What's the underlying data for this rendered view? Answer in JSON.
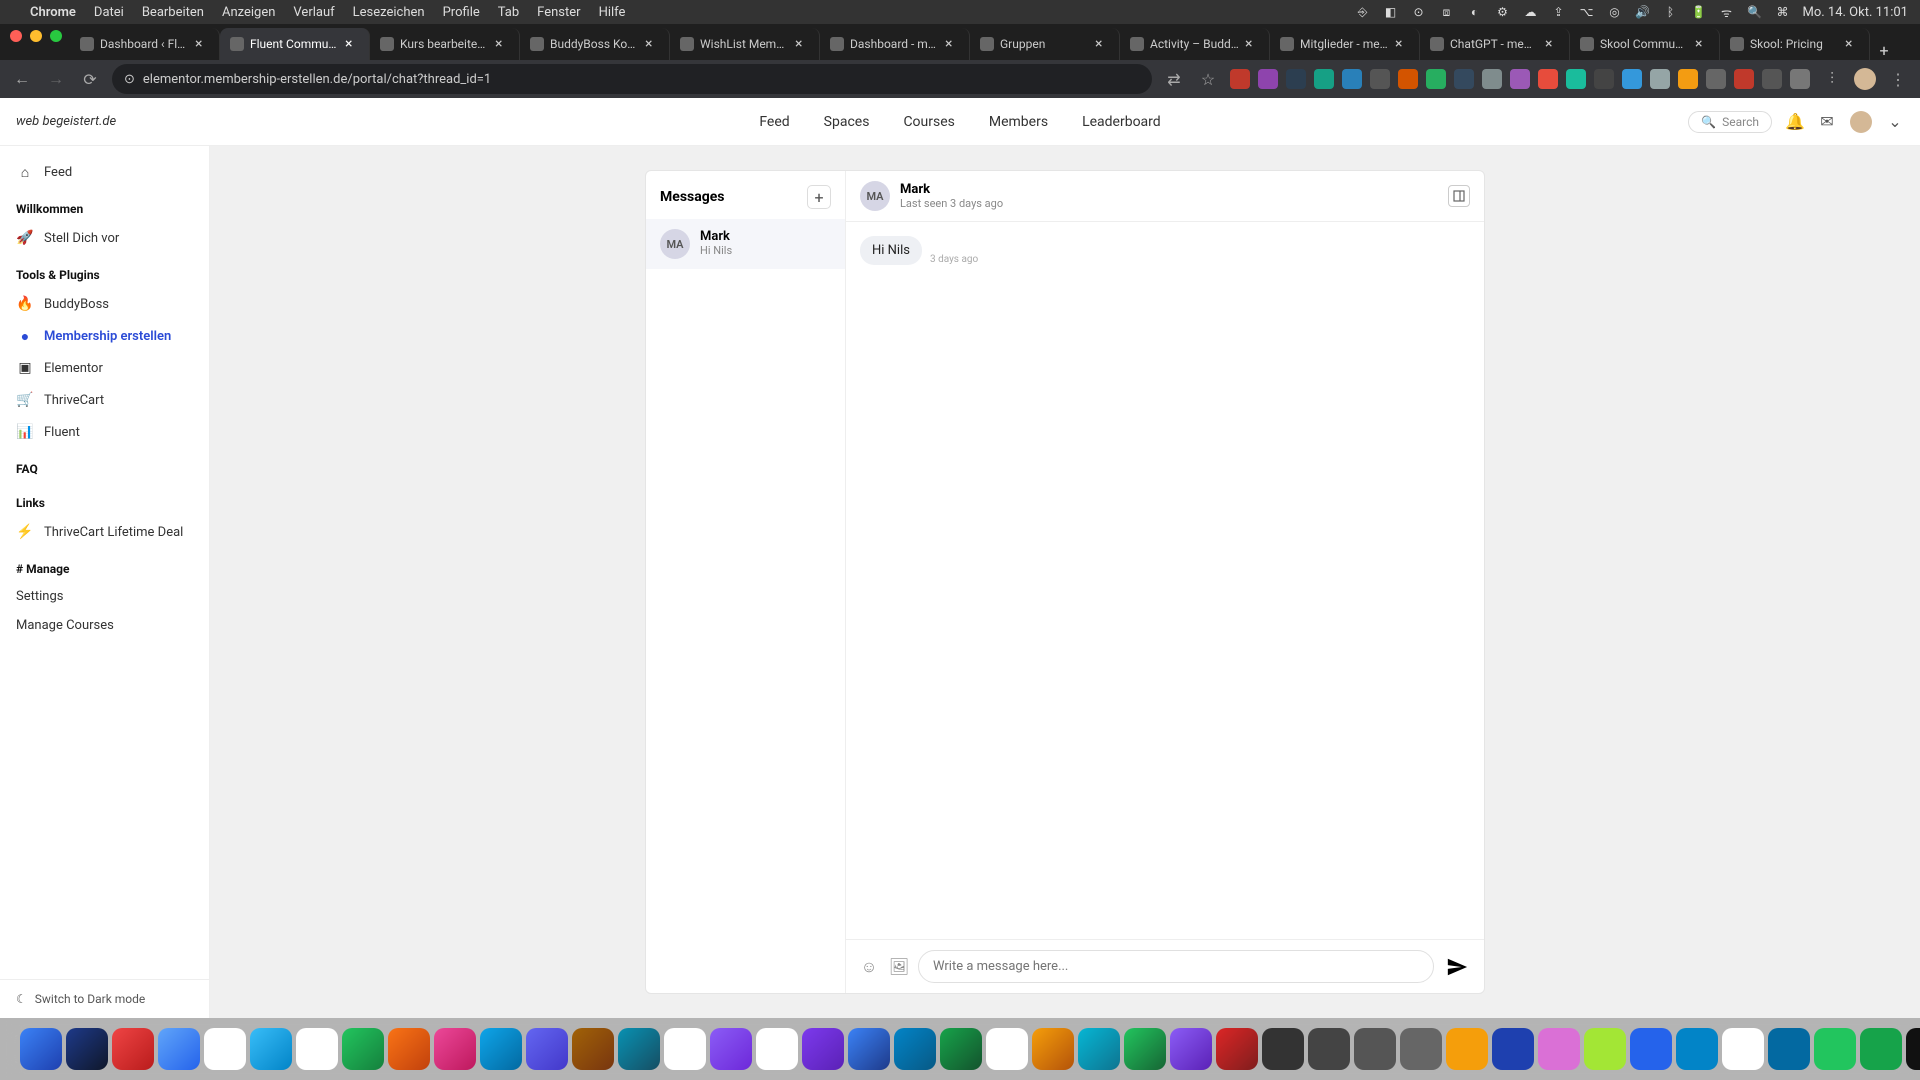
{
  "menubar": {
    "app": "Chrome",
    "items": [
      "Datei",
      "Bearbeiten",
      "Anzeigen",
      "Verlauf",
      "Lesezeichen",
      "Profile",
      "Tab",
      "Fenster",
      "Hilfe"
    ],
    "clock": "Mo. 14. Okt.  11:01"
  },
  "browser": {
    "tabs": [
      {
        "title": "Dashboard ‹ Fluent C"
      },
      {
        "title": "Fluent Community",
        "active": true
      },
      {
        "title": "Kurs bearbeiten „Ac"
      },
      {
        "title": "BuddyBoss Kompone"
      },
      {
        "title": "WishList Member | S"
      },
      {
        "title": "Dashboard - members"
      },
      {
        "title": "Gruppen"
      },
      {
        "title": "Activity – BuddyBoss"
      },
      {
        "title": "Mitglieder - members"
      },
      {
        "title": "ChatGPT - members"
      },
      {
        "title": "Skool Community"
      },
      {
        "title": "Skool: Pricing"
      }
    ],
    "url": "elementor.membership-erstellen.de/portal/chat?thread_id=1"
  },
  "header": {
    "logo": "web begeistert.de",
    "nav": [
      "Feed",
      "Spaces",
      "Courses",
      "Members",
      "Leaderboard"
    ],
    "search_placeholder": "Search"
  },
  "sidebar": {
    "feed": "Feed",
    "groups": [
      {
        "heading": "Willkommen",
        "items": [
          {
            "icon": "🚀",
            "label": "Stell Dich vor"
          }
        ]
      },
      {
        "heading": "Tools & Plugins",
        "items": [
          {
            "icon": "🔥",
            "label": "BuddyBoss"
          },
          {
            "icon": "●",
            "label": "Membership erstellen",
            "active": true
          },
          {
            "icon": "▣",
            "label": "Elementor"
          },
          {
            "icon": "🛒",
            "label": "ThriveCart"
          },
          {
            "icon": "📊",
            "label": "Fluent"
          }
        ]
      },
      {
        "heading": "FAQ",
        "items": []
      },
      {
        "heading": "Links",
        "items": [
          {
            "icon": "⚡",
            "label": "ThriveCart Lifetime Deal"
          }
        ]
      },
      {
        "heading": "# Manage",
        "items": [
          {
            "icon": "",
            "label": "Settings"
          },
          {
            "icon": "",
            "label": "Manage Courses"
          }
        ]
      }
    ],
    "dark_mode": "Switch to Dark mode"
  },
  "messenger": {
    "title": "Messages",
    "threads": [
      {
        "avatar": "MA",
        "name": "Mark",
        "preview": "Hi Nils"
      }
    ],
    "chat": {
      "avatar": "MA",
      "name": "Mark",
      "sub": "Last seen 3 days ago",
      "messages": [
        {
          "text": "Hi Nils",
          "time": "3 days ago"
        }
      ],
      "input_placeholder": "Write a message here..."
    }
  }
}
